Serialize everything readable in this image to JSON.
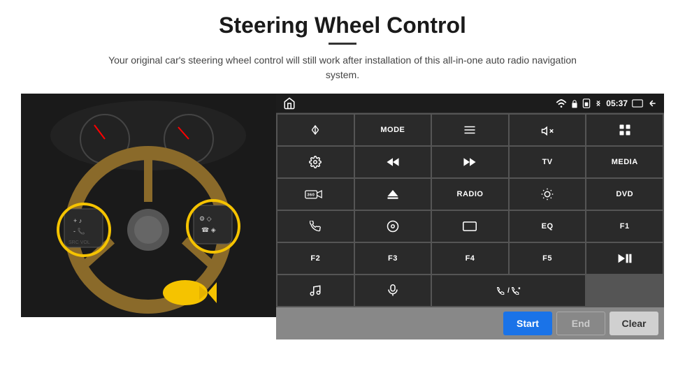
{
  "header": {
    "title": "Steering Wheel Control",
    "subtitle": "Your original car's steering wheel control will still work after installation of this all-in-one auto radio navigation system."
  },
  "statusBar": {
    "time": "05:37"
  },
  "buttons": [
    {
      "id": "home",
      "label": "⌂",
      "type": "icon"
    },
    {
      "id": "nav",
      "label": "➤",
      "type": "icon"
    },
    {
      "id": "mode",
      "label": "MODE",
      "type": "text"
    },
    {
      "id": "list",
      "label": "≡",
      "type": "icon"
    },
    {
      "id": "mute",
      "label": "🔇",
      "type": "icon"
    },
    {
      "id": "apps",
      "label": "⊞",
      "type": "icon"
    },
    {
      "id": "settings",
      "label": "⚙",
      "type": "icon"
    },
    {
      "id": "rewind",
      "label": "⏮",
      "type": "icon"
    },
    {
      "id": "forward",
      "label": "⏭",
      "type": "icon"
    },
    {
      "id": "tv",
      "label": "TV",
      "type": "text"
    },
    {
      "id": "media",
      "label": "MEDIA",
      "type": "text"
    },
    {
      "id": "cam360",
      "label": "360",
      "type": "icon"
    },
    {
      "id": "eject",
      "label": "⏏",
      "type": "icon"
    },
    {
      "id": "radio",
      "label": "RADIO",
      "type": "text"
    },
    {
      "id": "brightness",
      "label": "☼",
      "type": "icon"
    },
    {
      "id": "dvd",
      "label": "DVD",
      "type": "text"
    },
    {
      "id": "phone",
      "label": "📞",
      "type": "icon"
    },
    {
      "id": "nav2",
      "label": "◎",
      "type": "icon"
    },
    {
      "id": "screen",
      "label": "▭",
      "type": "icon"
    },
    {
      "id": "eq",
      "label": "EQ",
      "type": "text"
    },
    {
      "id": "f1",
      "label": "F1",
      "type": "text"
    },
    {
      "id": "f2",
      "label": "F2",
      "type": "text"
    },
    {
      "id": "f3",
      "label": "F3",
      "type": "text"
    },
    {
      "id": "f4",
      "label": "F4",
      "type": "text"
    },
    {
      "id": "f5",
      "label": "F5",
      "type": "text"
    },
    {
      "id": "playpause",
      "label": "▶⏸",
      "type": "icon"
    },
    {
      "id": "music",
      "label": "♪",
      "type": "icon"
    },
    {
      "id": "mic",
      "label": "🎤",
      "type": "icon"
    },
    {
      "id": "vol",
      "label": "🔈/📞",
      "type": "icon"
    }
  ],
  "actionBar": {
    "startLabel": "Start",
    "endLabel": "End",
    "clearLabel": "Clear"
  }
}
